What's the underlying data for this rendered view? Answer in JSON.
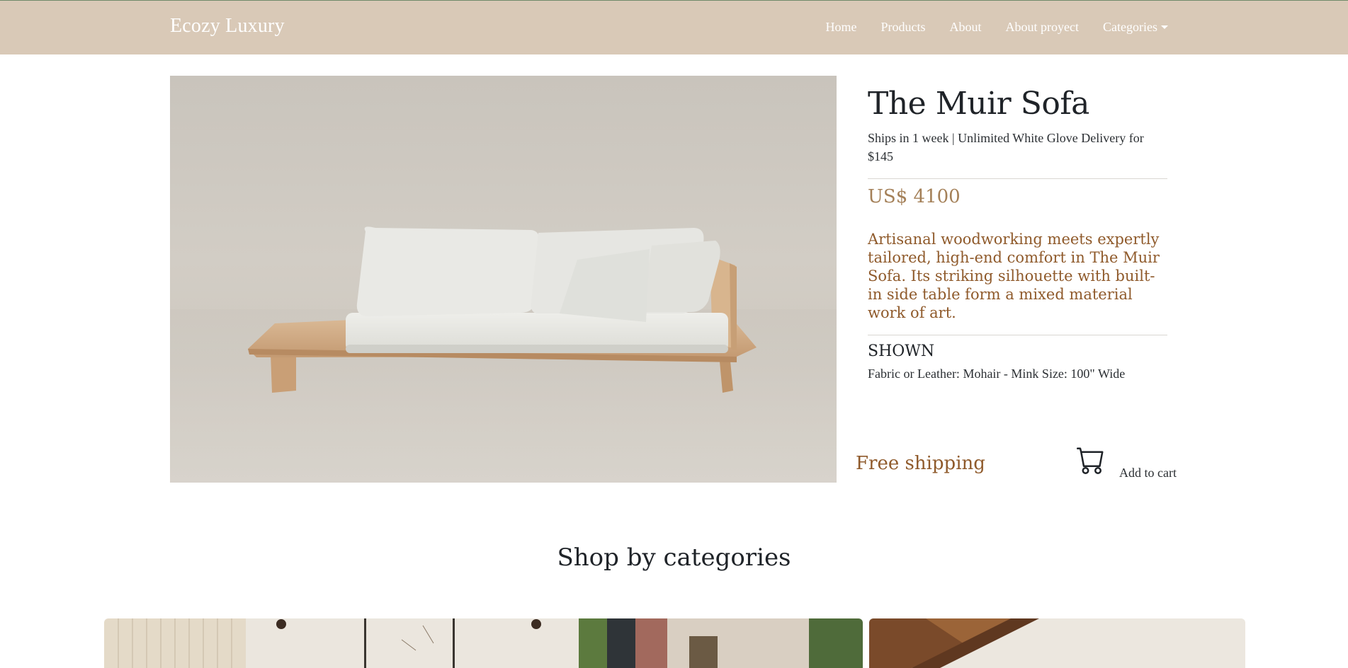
{
  "navbar": {
    "brand": "Ecozy Luxury",
    "links": [
      "Home",
      "Products",
      "About",
      "About proyect",
      "Categories"
    ]
  },
  "product": {
    "title": "The Muir Sofa",
    "shipping_note": "Ships in 1 week | Unlimited White Glove Delivery for $145",
    "price": "US$ 4100",
    "description": "Artisanal woodworking meets expertly tailored, high-end comfort in The Muir Sofa. Its striking silhouette with built-in side table form a mixed material work of art.",
    "shown_heading": "SHOWN",
    "shown_detail": "Fabric or Leather: Mohair - Mink Size: 100\" Wide",
    "free_shipping": "Free shipping",
    "add_to_cart": "Add to cart"
  },
  "categories": {
    "heading": "Shop by categories"
  },
  "colors": {
    "navbar_bg": "#d9c9b7",
    "accent_brown": "#8f5a2b",
    "price": "#a48058"
  }
}
